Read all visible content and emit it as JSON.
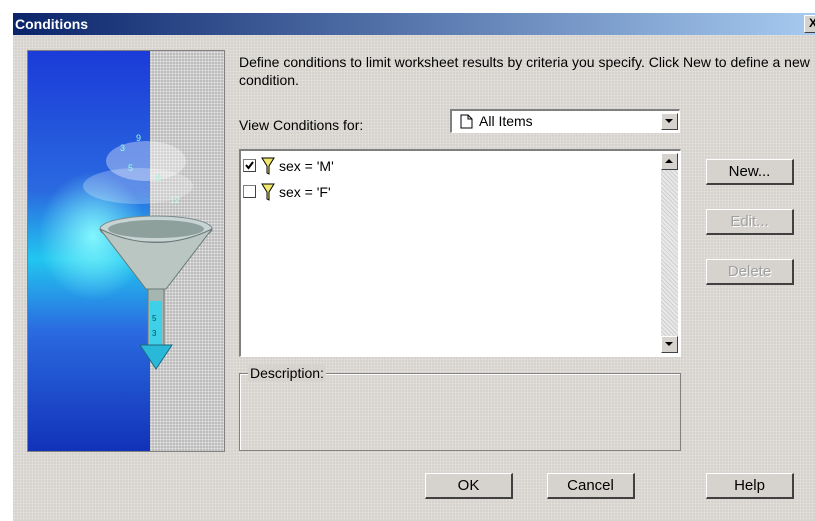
{
  "window": {
    "title": "Conditions",
    "close_glyph": "X"
  },
  "intro_text": "Define conditions to limit worksheet results by criteria you specify. Click New to define a new condition.",
  "view_for": {
    "label": "View Conditions for:",
    "selected": "All Items",
    "icon": "document-icon"
  },
  "conditions": [
    {
      "text": "sex = 'M'",
      "checked": true,
      "icon": "funnel-icon"
    },
    {
      "text": "sex = 'F'",
      "checked": false,
      "icon": "funnel-icon"
    }
  ],
  "description": {
    "label": "Description:",
    "text": ""
  },
  "side_buttons": {
    "new": "New...",
    "edit": "Edit...",
    "delete": "Delete",
    "edit_enabled": false,
    "delete_enabled": false
  },
  "footer_buttons": {
    "ok": "OK",
    "cancel": "Cancel",
    "help": "Help"
  },
  "colors": {
    "dialog_bg": "#d6d3ce",
    "title_start": "#0a246a",
    "title_end": "#a6caf0",
    "art_blue": "#1b3bd8",
    "art_cyan": "#22c6ef"
  }
}
